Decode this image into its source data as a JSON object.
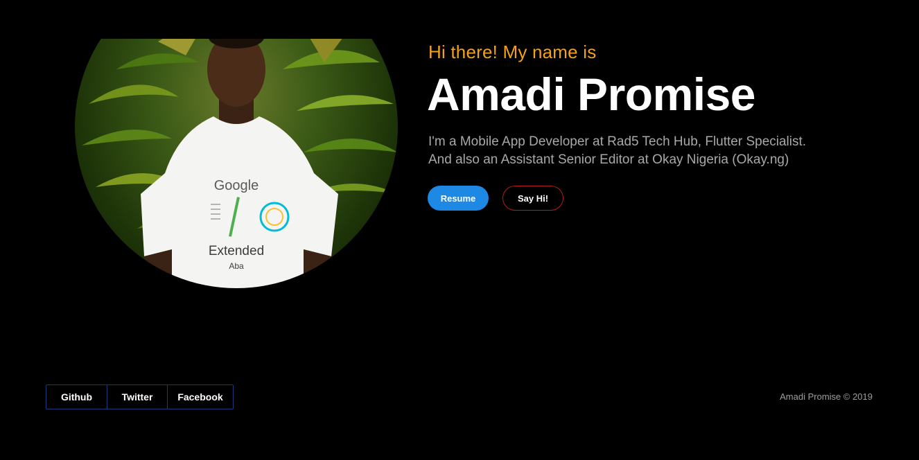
{
  "hero": {
    "greeting": "Hi there! My name is",
    "name": "Amadi Promise",
    "bio_line1": "I'm a Mobile App Developer at Rad5 Tech Hub, Flutter Specialist.",
    "bio_line2": "And also an Assistant Senior Editor at Okay Nigeria (Okay.ng)"
  },
  "actions": {
    "resume_label": "Resume",
    "sayhi_label": "Say Hi!"
  },
  "photo": {
    "shirt_text_top": "Google",
    "shirt_text_mid": "Extended",
    "shirt_text_bottom": "Aba"
  },
  "footer": {
    "social": [
      "Github",
      "Twitter",
      "Facebook"
    ],
    "copyright": "Amadi Promise © 2019"
  },
  "colors": {
    "background": "#000000",
    "greeting": "#f4a11a",
    "resume_button": "#1e88e5",
    "sayhi_border": "#b71c1c",
    "social_border": "#1a3a7a"
  }
}
